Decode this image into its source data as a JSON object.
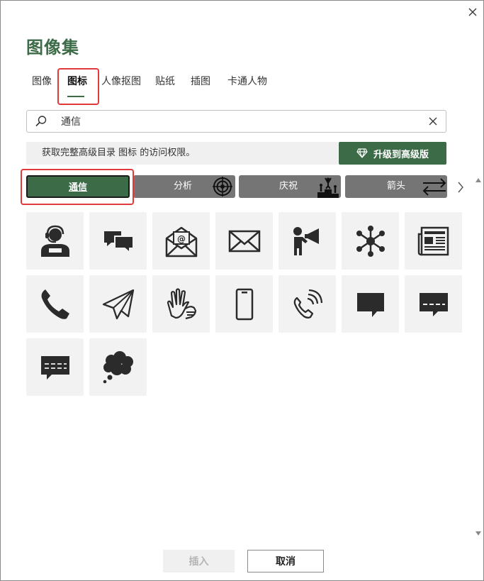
{
  "dialog": {
    "title": "图像集",
    "close_icon": "close-icon"
  },
  "tabs": [
    {
      "label": "图像",
      "active": false
    },
    {
      "label": "图标",
      "active": true
    },
    {
      "label": "人像抠图",
      "active": false
    },
    {
      "label": "贴纸",
      "active": false
    },
    {
      "label": "插图",
      "active": false
    },
    {
      "label": "卡通人物",
      "active": false
    }
  ],
  "search": {
    "value": "通信",
    "placeholder": "",
    "icon": "search-icon",
    "clear_icon": "clear-icon"
  },
  "notice": {
    "text": "获取完整高级目录 图标 的访问权限。"
  },
  "upgrade": {
    "label": "升级到高级版",
    "icon": "diamond-icon"
  },
  "categories": [
    {
      "label": "通信",
      "active": true,
      "icon": ""
    },
    {
      "label": "分析",
      "active": false,
      "icon": "target-icon"
    },
    {
      "label": "庆祝",
      "active": false,
      "icon": "podium-icon"
    },
    {
      "label": "箭头",
      "active": false,
      "icon": "swap-arrows-icon"
    }
  ],
  "icons": [
    {
      "name": "headset-person-icon"
    },
    {
      "name": "chat-bubbles-icon"
    },
    {
      "name": "email-open-icon"
    },
    {
      "name": "envelope-icon"
    },
    {
      "name": "megaphone-person-icon"
    },
    {
      "name": "network-icon"
    },
    {
      "name": "newspaper-icon"
    },
    {
      "name": "phone-icon"
    },
    {
      "name": "paper-plane-icon"
    },
    {
      "name": "sign-language-icon"
    },
    {
      "name": "mobile-phone-icon"
    },
    {
      "name": "phone-ringing-icon"
    },
    {
      "name": "speech-bubble-icon"
    },
    {
      "name": "speech-bubble-text-icon"
    },
    {
      "name": "speech-bubble-dashes-icon"
    },
    {
      "name": "thought-bubble-icon"
    }
  ],
  "footer": {
    "insert_label": "插入",
    "cancel_label": "取消"
  },
  "colors": {
    "accent": "#3c6b47",
    "category_bg": "#757575",
    "highlight": "#e03a3a",
    "tile_bg": "#f2f2f2",
    "icon": "#2b2b2b"
  }
}
